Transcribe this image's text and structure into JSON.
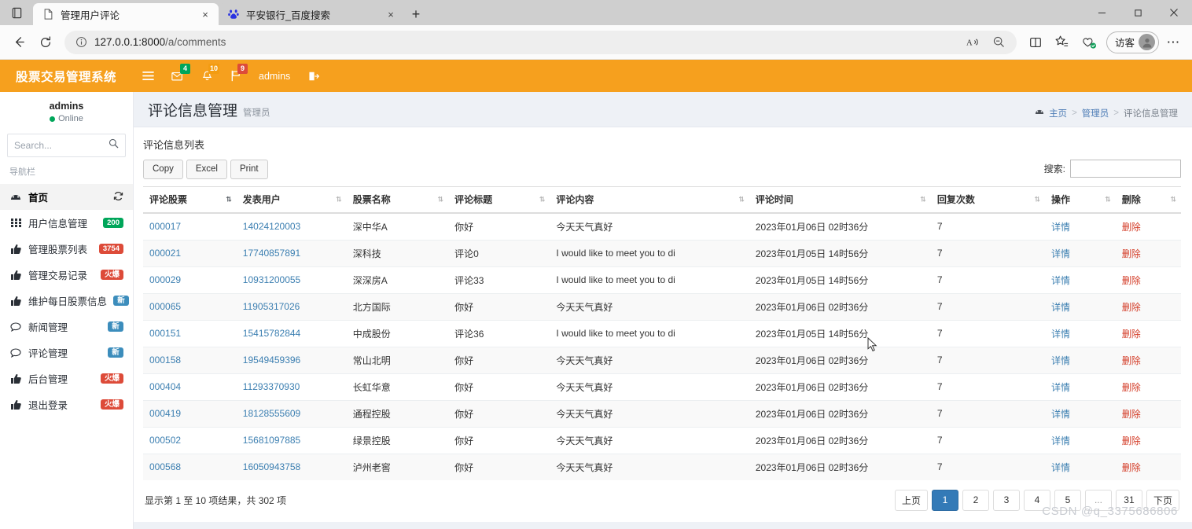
{
  "browser": {
    "tabs": [
      {
        "title": "管理用户评论",
        "favicon": "page-icon",
        "active": true,
        "close": "×"
      },
      {
        "title": "平安银行_百度搜索",
        "favicon": "baidu-icon",
        "active": false,
        "close": "×"
      }
    ],
    "new_tab_label": "+",
    "window_controls": {
      "minimize": "—",
      "maximize": "❐",
      "close": "✕"
    },
    "toolbar": {
      "back": "←",
      "reload": "⟳",
      "url_host": "127.0.0.1:8000",
      "url_path": "/a/comments",
      "read_aloud": "A",
      "zoom_out": "search-minus",
      "split_screen": "中",
      "favorites": "star",
      "collections": "heart",
      "profile_label": "访客",
      "more": "⋯"
    }
  },
  "app": {
    "brand": "股票交易管理系统",
    "header_items": [
      {
        "name": "menu-toggle",
        "icon": "☰",
        "badge": "",
        "badge_color": ""
      },
      {
        "name": "messages",
        "icon": "✉",
        "badge": "4",
        "badge_color": "green"
      },
      {
        "name": "notifications",
        "icon": "⚇",
        "badge": "10",
        "badge_color": "yellow"
      },
      {
        "name": "tasks",
        "icon": "⚑",
        "badge": "9",
        "badge_color": "red"
      },
      {
        "name": "user",
        "icon": "",
        "badge": "",
        "badge_color": "",
        "label": "admins"
      },
      {
        "name": "logout",
        "icon": "➦",
        "badge": "",
        "badge_color": ""
      }
    ]
  },
  "sidebar": {
    "user_name": "admins",
    "status": "Online",
    "search_placeholder": "Search...",
    "section_header": "导航栏",
    "items": [
      {
        "label": "首页",
        "icon": "dashboard-icon",
        "badge": "",
        "badge_color": "",
        "active": true,
        "trailing": "refresh-icon"
      },
      {
        "label": "用户信息管理",
        "icon": "grid-icon",
        "badge": "200",
        "badge_color": "#00a65a",
        "active": false
      },
      {
        "label": "管理股票列表",
        "icon": "thumb-icon",
        "badge": "3754",
        "badge_color": "#dd4b39",
        "active": false
      },
      {
        "label": "管理交易记录",
        "icon": "thumb-icon",
        "badge": "火爆",
        "badge_color": "#dd4b39",
        "active": false
      },
      {
        "label": "维护每日股票信息",
        "icon": "thumb-icon",
        "badge": "新",
        "badge_color": "#3c8dbc",
        "active": false
      },
      {
        "label": "新闻管理",
        "icon": "comment-icon",
        "badge": "新",
        "badge_color": "#3c8dbc",
        "active": false
      },
      {
        "label": "评论管理",
        "icon": "comment-icon",
        "badge": "新",
        "badge_color": "#3c8dbc",
        "active": false
      },
      {
        "label": "后台管理",
        "icon": "thumb-icon",
        "badge": "火爆",
        "badge_color": "#dd4b39",
        "active": false
      },
      {
        "label": "退出登录",
        "icon": "thumb-icon",
        "badge": "火爆",
        "badge_color": "#dd4b39",
        "active": false
      }
    ]
  },
  "page": {
    "title": "评论信息管理",
    "subtitle": "管理员",
    "breadcrumb": [
      "主页",
      "管理员",
      "评论信息管理"
    ],
    "panel_title": "评论信息列表",
    "buttons": {
      "copy": "Copy",
      "excel": "Excel",
      "print": "Print"
    },
    "search_label": "搜索:",
    "search_value": ""
  },
  "table": {
    "columns": [
      "评论股票",
      "发表用户",
      "股票名称",
      "评论标题",
      "评论内容",
      "评论时间",
      "回复次数",
      "操作",
      "删除"
    ],
    "rows": [
      [
        "000017",
        "14024120003",
        "深中华A",
        "你好",
        "今天天气真好",
        "2023年01月06日 02时36分",
        "7",
        "详情",
        "删除"
      ],
      [
        "000021",
        "17740857891",
        "深科技",
        "评论0",
        "I would like to meet you to di",
        "2023年01月05日 14时56分",
        "7",
        "详情",
        "删除"
      ],
      [
        "000029",
        "10931200055",
        "深深房A",
        "评论33",
        "I would like to meet you to di",
        "2023年01月05日 14时56分",
        "7",
        "详情",
        "删除"
      ],
      [
        "000065",
        "11905317026",
        "北方国际",
        "你好",
        "今天天气真好",
        "2023年01月06日 02时36分",
        "7",
        "详情",
        "删除"
      ],
      [
        "000151",
        "15415782844",
        "中成股份",
        "评论36",
        "I would like to meet you to di",
        "2023年01月05日 14时56分",
        "7",
        "详情",
        "删除"
      ],
      [
        "000158",
        "19549459396",
        "常山北明",
        "你好",
        "今天天气真好",
        "2023年01月06日 02时36分",
        "7",
        "详情",
        "删除"
      ],
      [
        "000404",
        "11293370930",
        "长虹华意",
        "你好",
        "今天天气真好",
        "2023年01月06日 02时36分",
        "7",
        "详情",
        "删除"
      ],
      [
        "000419",
        "18128555609",
        "通程控股",
        "你好",
        "今天天气真好",
        "2023年01月06日 02时36分",
        "7",
        "详情",
        "删除"
      ],
      [
        "000502",
        "15681097885",
        "绿景控股",
        "你好",
        "今天天气真好",
        "2023年01月06日 02时36分",
        "7",
        "详情",
        "删除"
      ],
      [
        "000568",
        "16050943758",
        "泸州老窖",
        "你好",
        "今天天气真好",
        "2023年01月06日 02时36分",
        "7",
        "详情",
        "删除"
      ]
    ],
    "info": "显示第 1 至 10 项结果，共 302 项",
    "pagination": {
      "prev": "上页",
      "pages": [
        "1",
        "2",
        "3",
        "4",
        "5",
        "...",
        "31"
      ],
      "active_page": "1",
      "next": "下页"
    }
  },
  "watermark": "CSDN @q_3375686806"
}
